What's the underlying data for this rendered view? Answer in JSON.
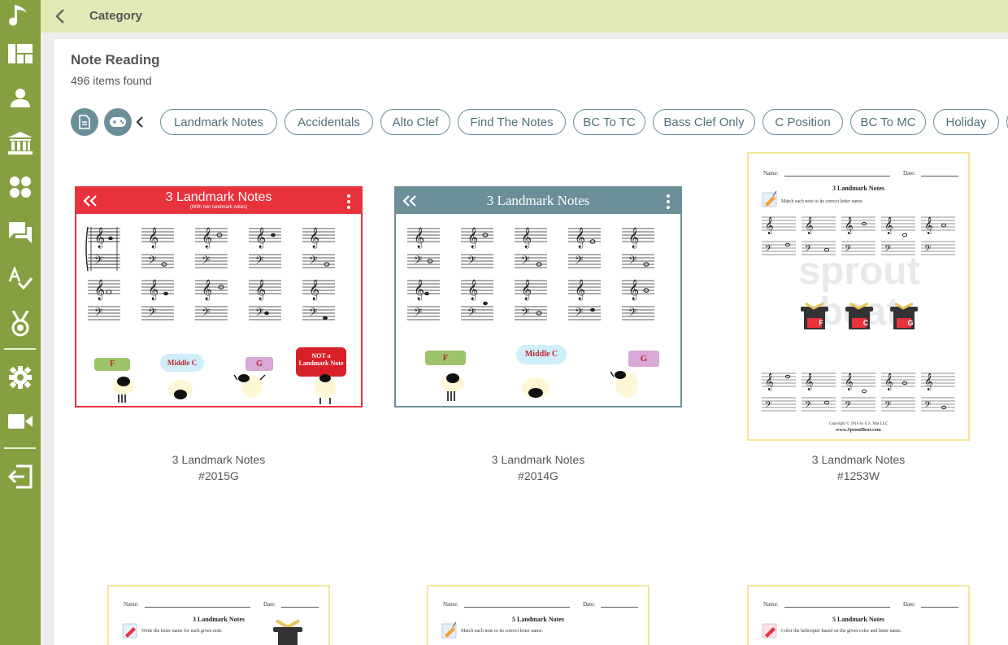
{
  "colors": {
    "sidebar": "#86a041",
    "topbar": "#e1eab7",
    "accent": "#6b8f99",
    "red_card": "#e8323c",
    "teal_card": "#6b8f99",
    "worksheet_border": "#f3e79a"
  },
  "sidebar": {
    "items": [
      {
        "icon": "music-note-icon"
      },
      {
        "icon": "dashboard-icon"
      },
      {
        "icon": "person-icon"
      },
      {
        "icon": "institution-icon"
      },
      {
        "icon": "groups-icon"
      },
      {
        "icon": "chat-icon"
      },
      {
        "icon": "spellcheck-icon"
      },
      {
        "icon": "medal-icon"
      },
      {
        "icon": "settings-icon"
      },
      {
        "icon": "video-icon"
      },
      {
        "icon": "logout-icon"
      }
    ]
  },
  "topbar": {
    "back_icon": "chevron-left-icon",
    "title": "Category"
  },
  "main": {
    "title": "Note Reading",
    "count": "496 items found",
    "type_filters": [
      {
        "icon": "document-icon"
      },
      {
        "icon": "gamepad-icon"
      }
    ],
    "chips": [
      "Landmark Notes",
      "Accidentals",
      "Alto Clef",
      "Find The Notes",
      "BC To TC",
      "Bass Clef Only",
      "C Position",
      "BC To MC",
      "Holiday"
    ]
  },
  "cards": [
    {
      "name": "3 Landmark Notes",
      "code": "#2015G",
      "header": "3 Landmark Notes",
      "subheader": "(With non landmark notes)",
      "labels": [
        "F",
        "Middle C",
        "G",
        "NOT a Landmark Note"
      ]
    },
    {
      "name": "3 Landmark Notes",
      "code": "#2014G",
      "header": "3 Landmark Notes",
      "labels": [
        "F",
        "Middle C",
        "G"
      ]
    },
    {
      "name": "3 Landmark Notes",
      "code": "#1253W",
      "ws": {
        "name_label": "Name:",
        "date_label": "Date:",
        "title": "3 Landmark Notes",
        "instruction": "Match each note to its correct letter name.",
        "hats": [
          "F",
          "C",
          "G"
        ],
        "copyright": "Copyright © 2016 by E.S. Mar LLC",
        "url": "www.SproutBeat.com"
      }
    }
  ],
  "row2": [
    {
      "ws": {
        "name_label": "Name:",
        "date_label": "Date:",
        "title": "3 Landmark Notes",
        "instruction": "Write the letter name for each given note."
      }
    },
    {
      "ws": {
        "name_label": "Name:",
        "date_label": "Date:",
        "title": "5 Landmark Notes",
        "instruction": "Match each note to its correct letter name."
      }
    },
    {
      "ws": {
        "name_label": "Name:",
        "date_label": "Date:",
        "title": "5 Landmark Notes",
        "instruction": "Color the helicopter based on the given color and letter name."
      }
    }
  ]
}
